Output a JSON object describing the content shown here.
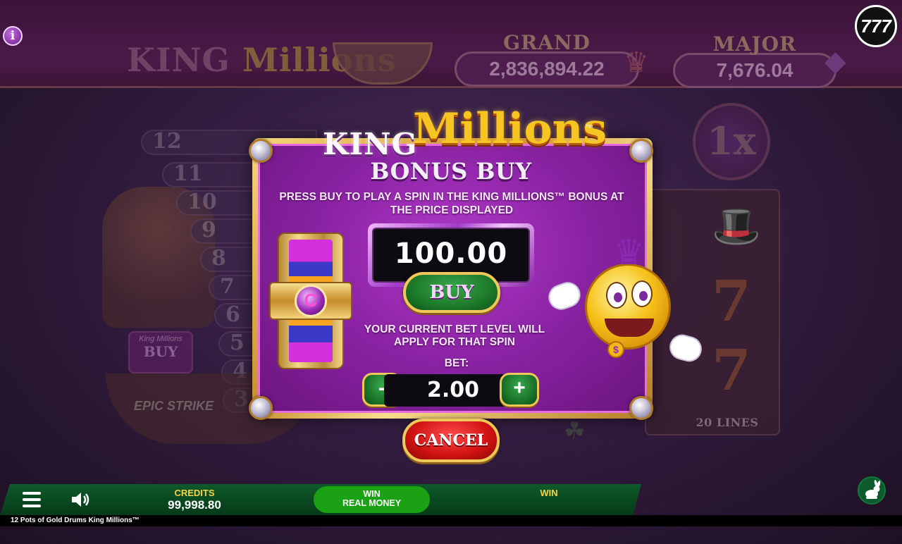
{
  "header": {
    "info_icon": "info-icon",
    "logo_king": "KING",
    "logo_millions": "Millions",
    "brand_badge": "777"
  },
  "jackpots": [
    {
      "name": "GRAND",
      "value": "2,836,894.22"
    },
    {
      "name": "MAJOR",
      "value": "7,676.04"
    }
  ],
  "background_board": {
    "pot_rows": [
      "12",
      "11",
      "10",
      "9",
      "8",
      "7",
      "6",
      "5",
      "4",
      "3"
    ],
    "side_buy": {
      "logo": "King Millions",
      "label": "BUY"
    },
    "epic_strike": "EPIC STRIKE",
    "multiplier": "1x",
    "lines": "20 LINES"
  },
  "modal": {
    "logo_king": "KING",
    "logo_millions": "Millions",
    "logo_tm": "™",
    "title": "BONUS BUY",
    "description": "PRESS BUY TO PLAY A SPIN IN THE KING MILLIONS™ BONUS AT THE PRICE DISPLAYED",
    "price": "100.00",
    "buy_label": "BUY",
    "bet_note": "YOUR CURRENT BET LEVEL WILL APPLY FOR THAT SPIN",
    "bet_label": "BET:",
    "bet_value": "2.00",
    "minus_label": "-",
    "plus_label": "+",
    "cancel_label": "CANCEL"
  },
  "bottom_bar": {
    "credits_label": "CREDITS",
    "credits_value": "99,998.80",
    "win_real_line1": "WIN",
    "win_real_line2": "REAL MONEY",
    "win_label": "WIN"
  },
  "footer": {
    "game_title": "12 Pots of Gold Drums King Millions™"
  },
  "colors": {
    "modal_purple": "#8d24a6",
    "gold_frame": "#f0c75a",
    "buy_green": "#1d7a2a",
    "cancel_red": "#cf1212",
    "bar_green": "#0e5a2a",
    "credits_yellow": "#f6d34a"
  }
}
